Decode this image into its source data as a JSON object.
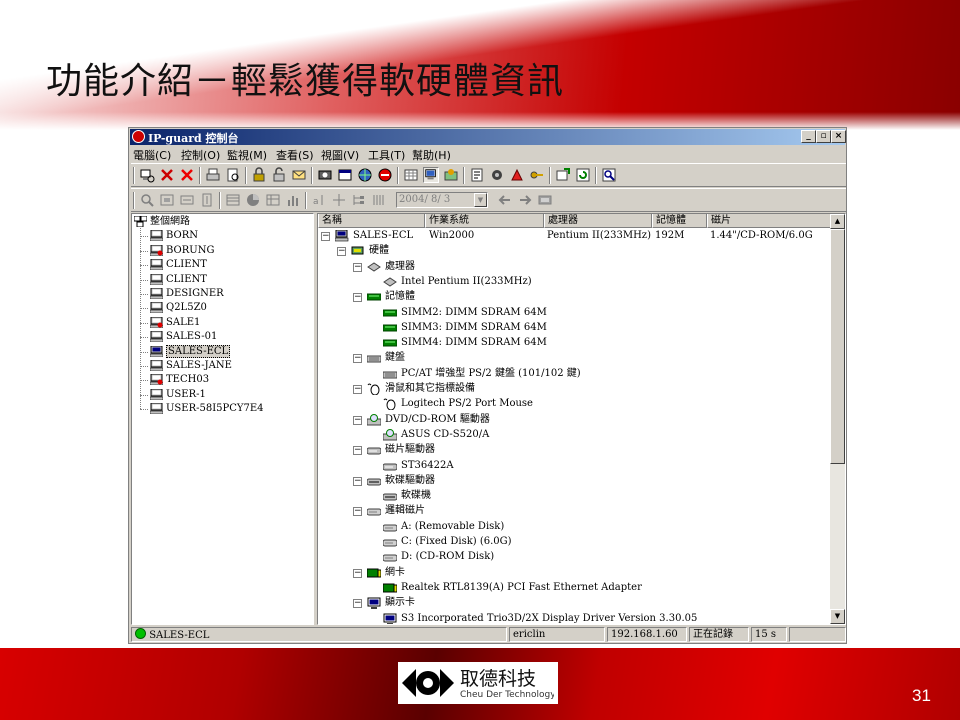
{
  "slide": {
    "title": "功能介紹－輕鬆獲得軟硬體資訊",
    "logo_cn": "取德科技",
    "logo_en": "Cheu Der Technology",
    "page_number": "31"
  },
  "window": {
    "title": "IP-guard 控制台",
    "buttons": [
      "_",
      "▫",
      "×"
    ],
    "menu": [
      "電腦(C)",
      "控制(O)",
      "監視(M)",
      "查看(S)",
      "視圖(V)",
      "工具(T)",
      "幫助(H)"
    ],
    "date_value": "2004/ 8/ 3"
  },
  "tree": {
    "root": "整個網路",
    "computers": [
      {
        "name": "BORN",
        "status": "normal"
      },
      {
        "name": "BORUNG",
        "status": "alert"
      },
      {
        "name": "CLIENT",
        "status": "normal"
      },
      {
        "name": "CLIENT",
        "status": "normal"
      },
      {
        "name": "DESIGNER",
        "status": "normal"
      },
      {
        "name": "Q2L5Z0",
        "status": "normal"
      },
      {
        "name": "SALE1",
        "status": "alert"
      },
      {
        "name": "SALES-01",
        "status": "normal"
      },
      {
        "name": "SALES-ECL",
        "status": "selected"
      },
      {
        "name": "SALES-JANE",
        "status": "normal"
      },
      {
        "name": "TECH03",
        "status": "alert"
      },
      {
        "name": "USER-1",
        "status": "normal"
      },
      {
        "name": "USER-58I5PCY7E4",
        "status": "normal"
      }
    ]
  },
  "detail": {
    "columns": [
      "名稱",
      "作業系統",
      "處理器",
      "記憶體",
      "磁片"
    ],
    "computer": {
      "name": "SALES-ECL",
      "os": "Win2000",
      "cpu": "Pentium II(233MHz)",
      "memory": "192M",
      "disk": "1.44\"/CD-ROM/6.0G"
    },
    "hardware_label": "硬體",
    "groups": [
      {
        "label": "處理器",
        "icon": "cpu-icon",
        "items": [
          "Intel Pentium II(233MHz)"
        ]
      },
      {
        "label": "記憶體",
        "icon": "memory-icon",
        "items": [
          "SIMM2: DIMM SDRAM  64M",
          "SIMM3: DIMM SDRAM  64M",
          "SIMM4: DIMM SDRAM  64M"
        ]
      },
      {
        "label": "鍵盤",
        "icon": "keyboard-icon",
        "items": [
          "PC/AT 增強型 PS/2 鍵盤 (101/102 鍵)"
        ]
      },
      {
        "label": "滑鼠和其它指標設備",
        "icon": "mouse-icon",
        "items": [
          "Logitech PS/2 Port Mouse"
        ]
      },
      {
        "label": "DVD/CD-ROM 驅動器",
        "icon": "cdrom-icon",
        "items": [
          "ASUS CD-S520/A"
        ]
      },
      {
        "label": "磁片驅動器",
        "icon": "disk-drive-icon",
        "items": [
          "ST36422A"
        ]
      },
      {
        "label": "軟碟驅動器",
        "icon": "floppy-drive-icon",
        "items": [
          "軟碟機"
        ]
      },
      {
        "label": "邏輯磁片",
        "icon": "logical-disk-icon",
        "items": [
          "A: (Removable Disk)",
          "C: (Fixed Disk) (6.0G)",
          "D: (CD-ROM Disk)"
        ]
      },
      {
        "label": "網卡",
        "icon": "network-card-icon",
        "items": [
          "Realtek RTL8139(A) PCI Fast Ethernet Adapter"
        ]
      },
      {
        "label": "顯示卡",
        "icon": "display-card-icon",
        "items": [
          "S3 Incorporated Trio3D/2X Display Driver Version 3.30.05"
        ]
      }
    ]
  },
  "status": {
    "computer": "SALES-ECL",
    "user": "ericlin",
    "ip": "192.168.1.60",
    "state": "正在記錄",
    "interval": "15 s"
  }
}
